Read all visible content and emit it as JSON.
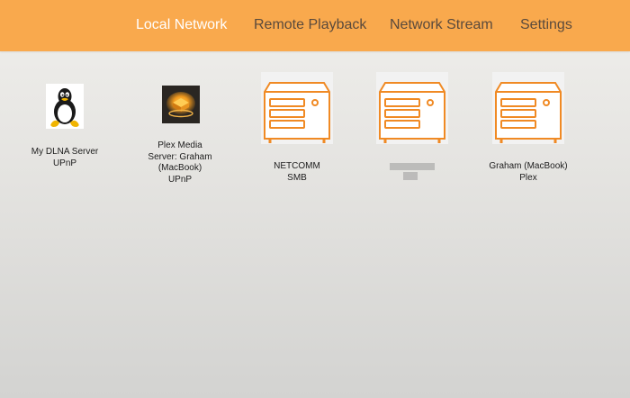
{
  "tabs": {
    "local_network": "Local Network",
    "remote_playback": "Remote Playback",
    "network_stream": "Network Stream",
    "settings": "Settings"
  },
  "servers": [
    {
      "icon": "linux-tux-icon",
      "name": "My DLNA Server",
      "type": "UPnP"
    },
    {
      "icon": "plex-icon",
      "name": "Plex Media Server: Graham (MacBook)",
      "type": "UPnP"
    },
    {
      "icon": "server-icon",
      "name": "NETCOMM",
      "type": "SMB"
    },
    {
      "icon": "server-icon",
      "name": "",
      "type": "",
      "redacted": true
    },
    {
      "icon": "server-icon",
      "name": "Graham (MacBook)",
      "type": "Plex"
    }
  ],
  "colors": {
    "header": "#f9a94d",
    "active_tab": "#ffffff",
    "inactive_tab": "#5a4a3c",
    "server_outline": "#f08a24"
  }
}
